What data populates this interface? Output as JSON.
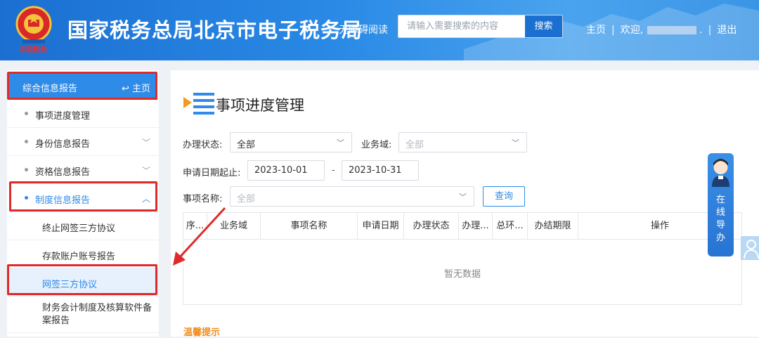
{
  "header": {
    "site_title": "国家税务总局北京市电子税务局",
    "a11y_label": "无障碍阅读",
    "search_placeholder": "请输入需要搜索的内容",
    "search_button": "搜索",
    "nav_home": "主页",
    "nav_sep": "|",
    "welcome": "欢迎,",
    "welcome_tail": ".",
    "logout": "退出",
    "emblem_text": "中国税务"
  },
  "sidebar": {
    "head_label": "综合信息报告",
    "head_home": "主页",
    "items": [
      {
        "label": "事项进度管理",
        "expandable": false
      },
      {
        "label": "身份信息报告",
        "expandable": true
      },
      {
        "label": "资格信息报告",
        "expandable": true
      },
      {
        "label": "制度信息报告",
        "expandable": true,
        "expanded": true
      }
    ],
    "sub_items": [
      {
        "label": "终止网签三方协议"
      },
      {
        "label": "存款账户账号报告"
      },
      {
        "label": "网签三方协议",
        "selected": true
      },
      {
        "label": "财务会计制度及核算软件备案报告"
      }
    ]
  },
  "main": {
    "title": "事项进度管理",
    "filters": {
      "status_label": "办理状态:",
      "status_value": "全部",
      "domain_label": "业务域:",
      "domain_placeholder": "全部",
      "date_label": "申请日期起止:",
      "date_from": "2023-10-01",
      "date_sep": "-",
      "date_to": "2023-10-31",
      "item_label": "事项名称:",
      "item_placeholder": "全部",
      "query_button": "查询"
    },
    "table": {
      "columns": [
        "序...",
        "业务域",
        "事项名称",
        "申请日期",
        "办理状态",
        "办理...",
        "总环...",
        "办结期限",
        "操作"
      ],
      "empty_text": "暂无数据"
    },
    "tip_label": "温馨提示"
  },
  "guide": {
    "label_chars": [
      "在",
      "线",
      "导",
      "办"
    ]
  },
  "colors": {
    "brand_blue": "#2e8be8",
    "header_blue": "#1b6fd1",
    "highlight_red": "#e02a2a",
    "tip_orange": "#f08c1a"
  }
}
